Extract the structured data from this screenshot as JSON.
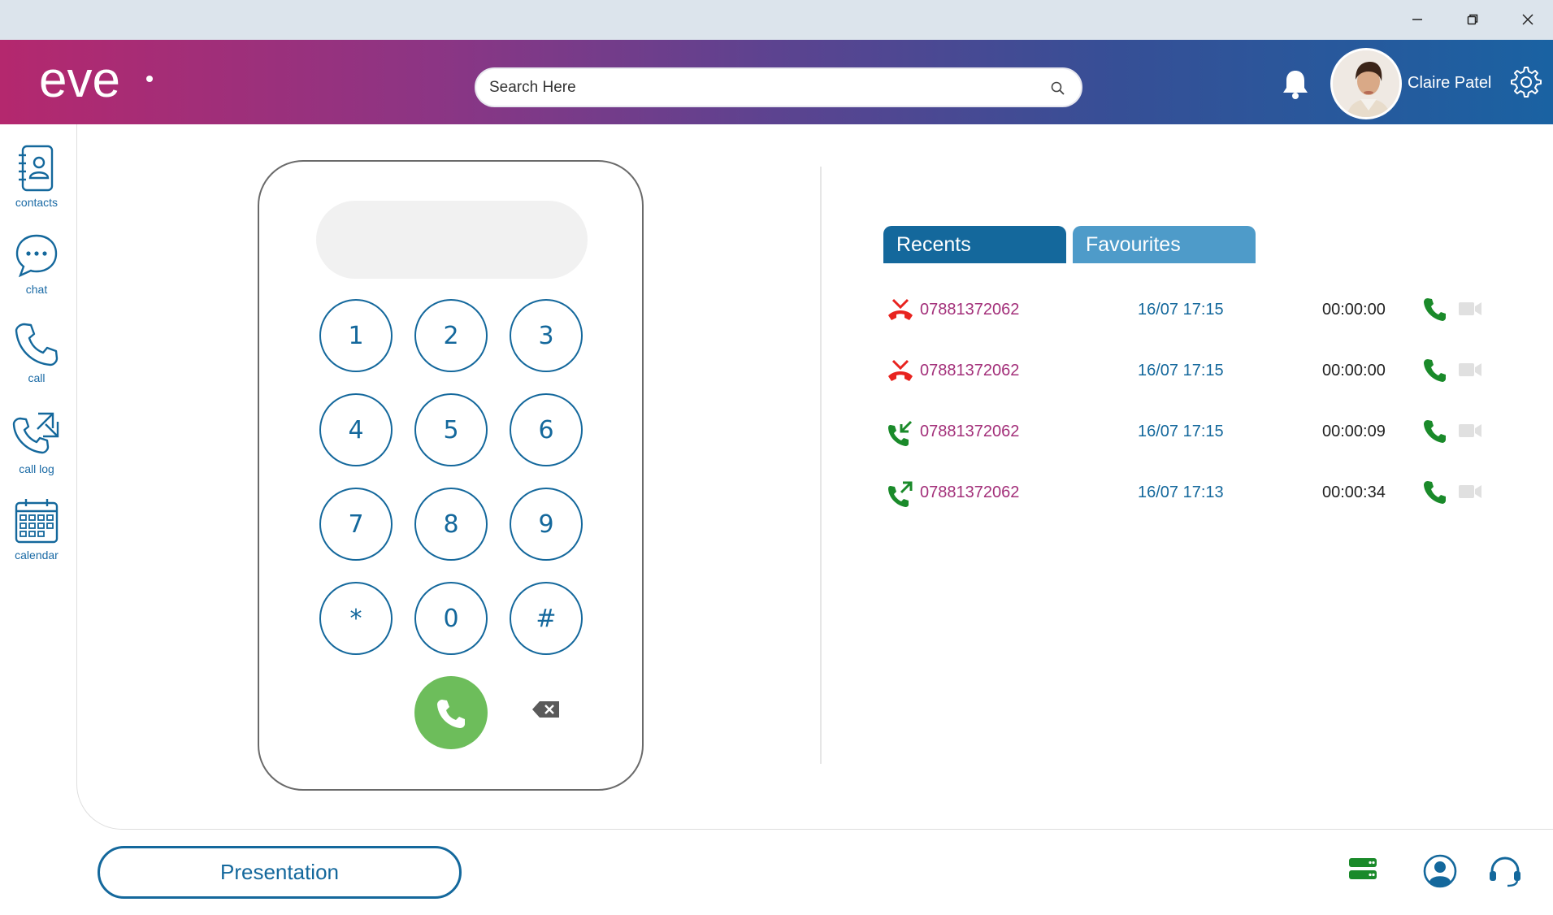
{
  "window": {
    "controls": [
      "minimize-icon",
      "restore-icon",
      "close-icon"
    ]
  },
  "header": {
    "logo_text": "eve",
    "search_placeholder": "Search Here",
    "user_name": "Claire Patel"
  },
  "sidebar": {
    "items": [
      {
        "label": "contacts",
        "icon": "contacts-book-icon"
      },
      {
        "label": "chat",
        "icon": "chat-bubble-icon"
      },
      {
        "label": "call",
        "icon": "phone-icon"
      },
      {
        "label": "call log",
        "icon": "call-log-icon"
      },
      {
        "label": "calendar",
        "icon": "calendar-icon"
      }
    ]
  },
  "dialpad": {
    "display_value": "",
    "keys": [
      "1",
      "2",
      "3",
      "4",
      "5",
      "6",
      "7",
      "8",
      "9",
      "*",
      "0",
      "#"
    ]
  },
  "tabs": {
    "recents": "Recents",
    "favourites": "Favourites"
  },
  "recents": [
    {
      "type": "missed",
      "number": "07881372062",
      "time": "16/07 17:15",
      "duration": "00:00:00"
    },
    {
      "type": "missed",
      "number": "07881372062",
      "time": "16/07 17:15",
      "duration": "00:00:00"
    },
    {
      "type": "incoming",
      "number": "07881372062",
      "time": "16/07 17:15",
      "duration": "00:00:09"
    },
    {
      "type": "outgoing",
      "number": "07881372062",
      "time": "16/07 17:13",
      "duration": "00:00:34"
    }
  ],
  "footer": {
    "presentation_label": "Presentation"
  },
  "colors": {
    "brand_blue": "#14689c",
    "tab_light_blue": "#4e9bc9",
    "missed_red": "#e8231f",
    "answered_green": "#1a8a2a",
    "call_button_green": "#6dbd5b",
    "number_magenta": "#a3307a"
  }
}
